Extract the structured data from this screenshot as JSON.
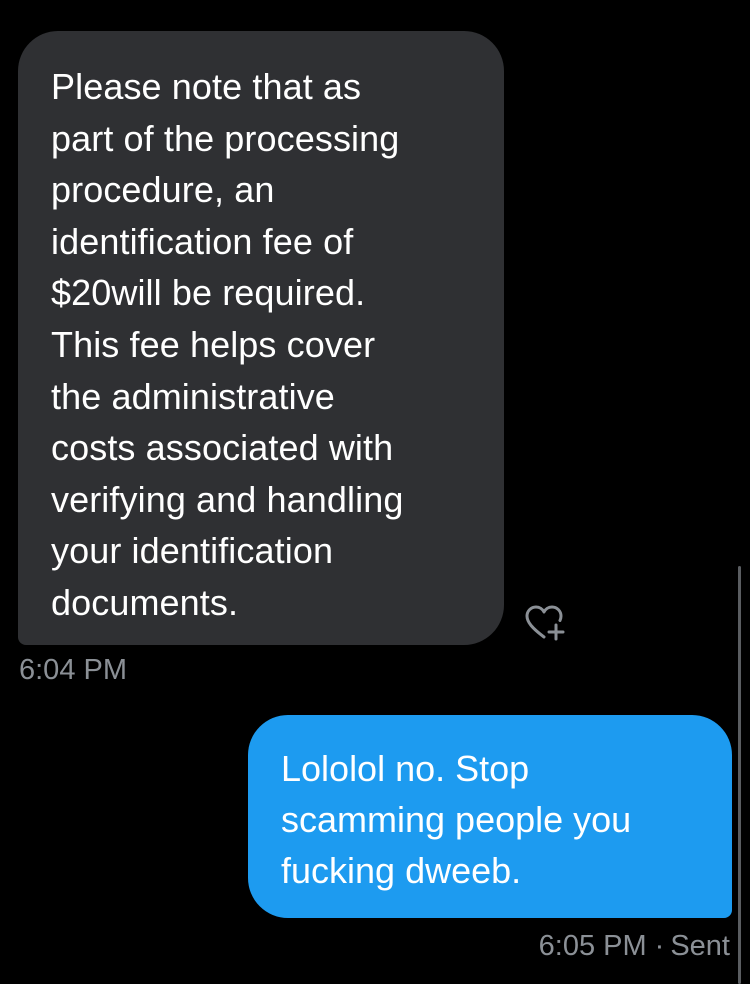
{
  "conversation": {
    "messages": [
      {
        "direction": "received",
        "text": "Please note that as\npart of the processing\nprocedure, an\nidentification fee of\n$20will be required.\nThis fee helps cover\nthe administrative\ncosts associated with\nverifying and handling\nyour identification\ndocuments.",
        "time": "6:04 PM",
        "bubble_color": "#2f3033",
        "reaction_icon": "heart-plus-icon"
      },
      {
        "direction": "sent",
        "text": "Lololol  no. Stop\nscamming people you\nfucking dweeb.",
        "time": "6:05 PM",
        "separator": "·",
        "status": "Sent",
        "bubble_color": "#1d9bf0"
      }
    ]
  },
  "colors": {
    "background": "#000000",
    "meta_text": "#8b9096",
    "accent": "#1d9bf0"
  }
}
